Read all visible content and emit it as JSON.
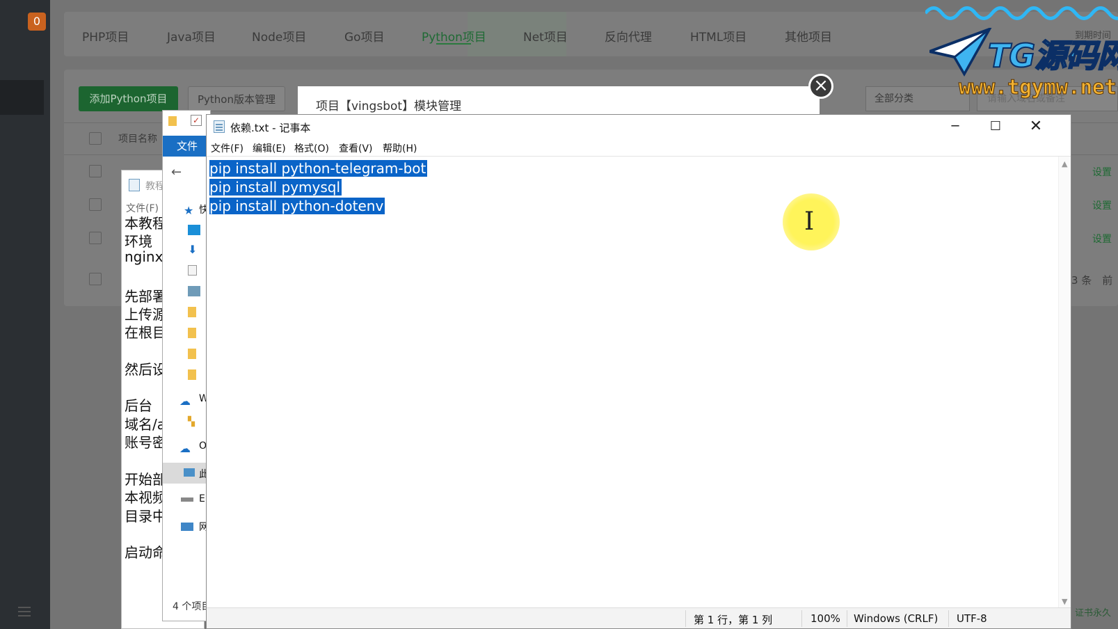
{
  "sidebar": {
    "badge": "0"
  },
  "tabs": [
    {
      "label": "PHP项目"
    },
    {
      "label": "Java项目"
    },
    {
      "label": "Node项目"
    },
    {
      "label": "Go项目"
    },
    {
      "label": "Python项目",
      "active": true
    },
    {
      "label": "Net项目"
    },
    {
      "label": "反向代理"
    },
    {
      "label": "HTML项目"
    },
    {
      "label": "其他项目"
    }
  ],
  "toolbar": {
    "add_python": "添加Python项目",
    "python_version": "Python版本管理",
    "category": "全部分类",
    "search_placeholder": "请输入域名或备注"
  },
  "table": {
    "col_name": "项目名称",
    "row_action": "设置",
    "pager_text": "3 条　前"
  },
  "footer_note": "证书永久",
  "dialog": {
    "title": "项目【vingsbot】模块管理"
  },
  "tutorial_notepad": {
    "title": "教程",
    "menu": "文件(F)",
    "lines": [
      "本教程",
      "环境",
      "nginx",
      "",
      "先部署",
      "上传源",
      "在根目",
      "",
      "然后设",
      "",
      "后台",
      "域名/a",
      "账号密",
      "",
      "开始部",
      "本视频",
      "目录中",
      "",
      "启动命"
    ]
  },
  "explorer": {
    "file_tab": "文件",
    "status": "4 个项目",
    "items": [
      "快",
      "W",
      "O",
      "此",
      "E",
      "网"
    ]
  },
  "notepad": {
    "title": "依赖.txt - 记事本",
    "menus": [
      "文件(F)",
      "编辑(E)",
      "格式(O)",
      "查看(V)",
      "帮助(H)"
    ],
    "lines": [
      "pip install python-telegram-bot",
      "pip install pymysql",
      "pip install python-dotenv"
    ],
    "status": {
      "position": "第 1 行，第 1 列",
      "zoom": "100%",
      "line_ending": "Windows (CRLF)",
      "encoding": "UTF-8"
    }
  },
  "watermark": {
    "logo": "TG源码网",
    "url": "www.tgymw.net",
    "expire": "到期时间"
  },
  "colors": {
    "selection": "#0a64c8",
    "accent_green": "#1c6530",
    "cursor_highlight": "#fff45a"
  }
}
